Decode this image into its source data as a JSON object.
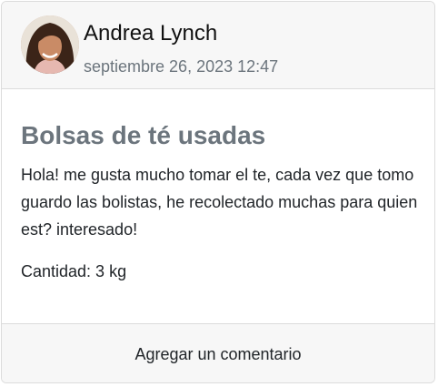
{
  "post": {
    "author": {
      "name": "Andrea Lynch",
      "date": "septiembre 26, 2023 12:47"
    },
    "title": "Bolsas de té usadas",
    "body": "Hola! me gusta mucho tomar el te, cada vez que tomo guardo las bolistas, he recolectado muchas para quien est? interesado!",
    "quantity": "Cantidad: 3 kg",
    "footer": {
      "comment_label": "Agregar un comentario"
    }
  },
  "colors": {
    "header_bg": "#f7f7f7",
    "muted_text": "#6c757d",
    "border": "#dcdcdc"
  }
}
